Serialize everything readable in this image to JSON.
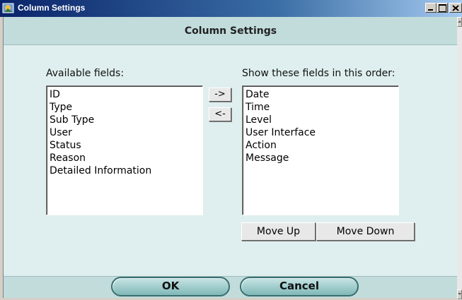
{
  "window": {
    "title": "Column Settings",
    "icon": "app-icon"
  },
  "dialog": {
    "heading": "Column Settings",
    "available_label": "Available fields:",
    "show_label": "Show these fields in this order:",
    "available_fields": [
      "ID",
      "Type",
      "Sub Type",
      "User",
      "Status",
      "Reason",
      "Detailed Information"
    ],
    "shown_fields": [
      "Date",
      "Time",
      "Level",
      "User Interface",
      "Action",
      "Message"
    ],
    "add_button": "->",
    "remove_button": "<-",
    "move_up_button": "Move Up",
    "move_down_button": "Move Down",
    "ok_button": "OK",
    "cancel_button": "Cancel"
  },
  "colors": {
    "content_bg": "#dfeeee",
    "band_bg": "#c2dcdc",
    "pill_border": "#3a6e6e"
  }
}
